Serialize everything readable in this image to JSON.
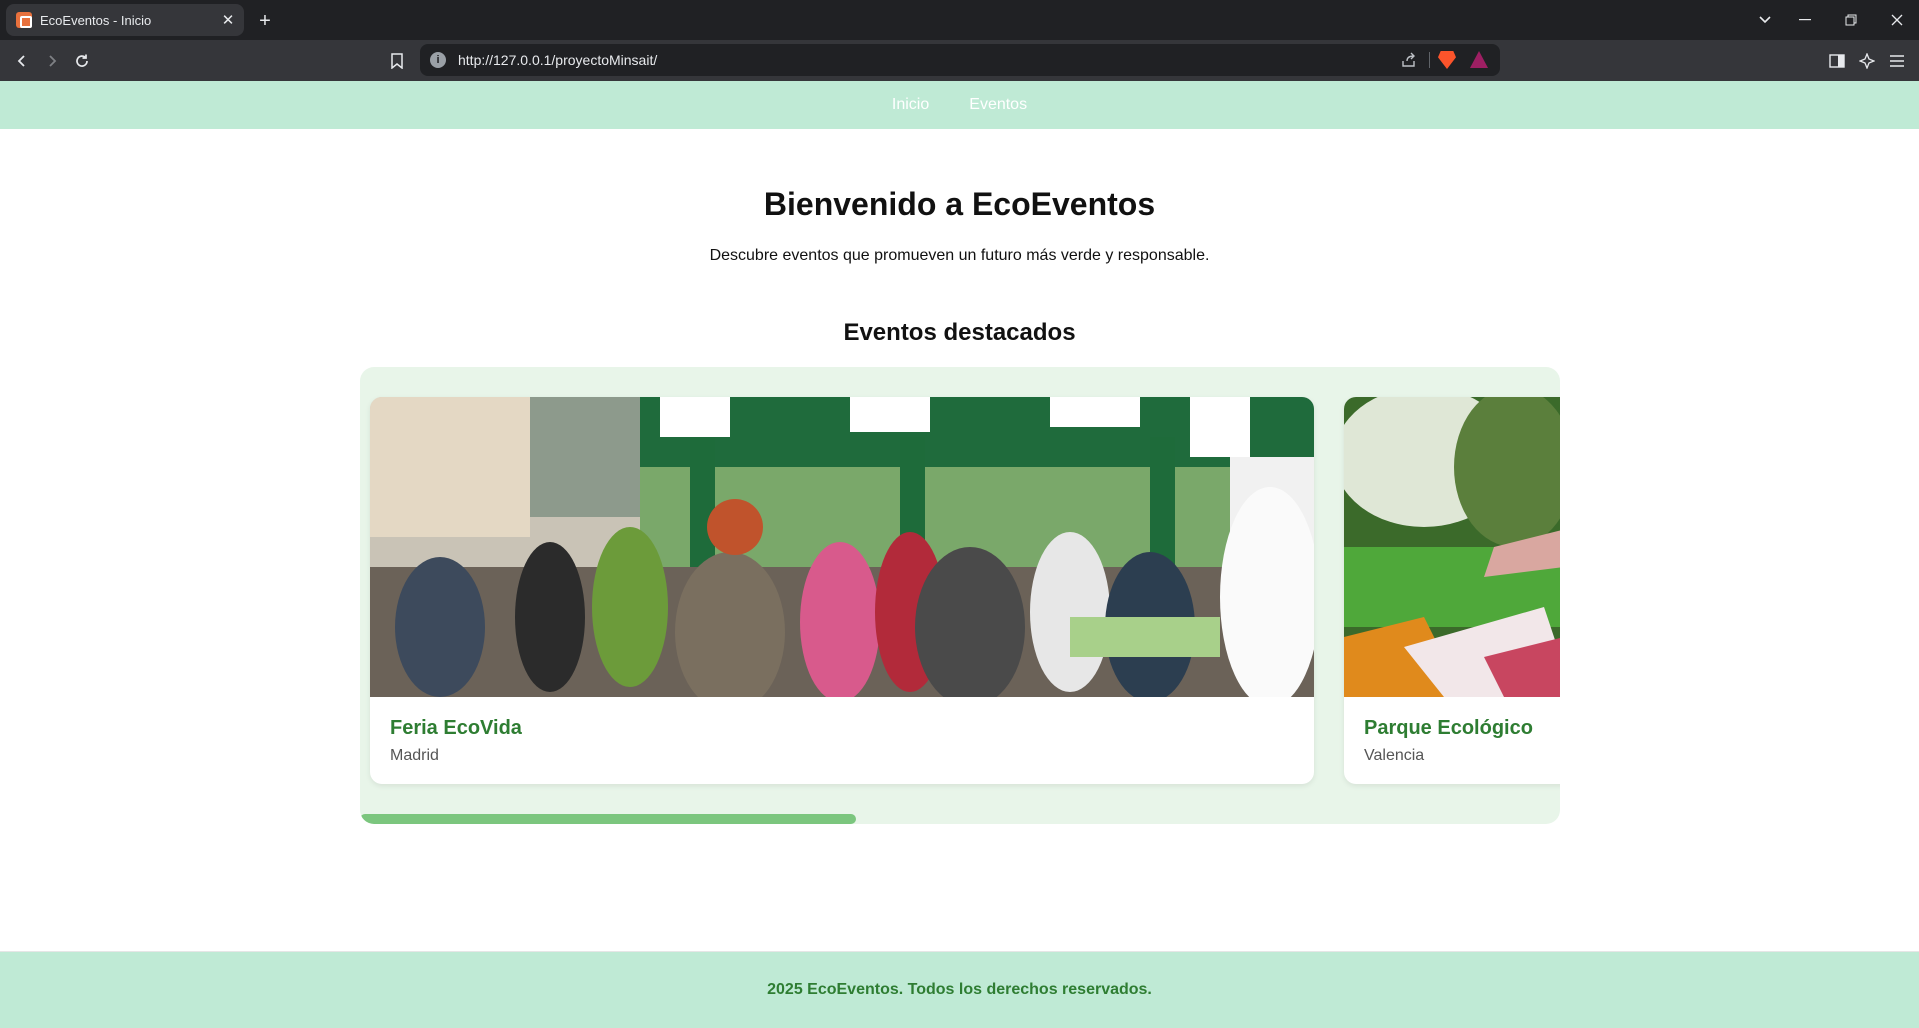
{
  "browser": {
    "tab_title": "EcoEventos - Inicio",
    "tab_close": "✕",
    "new_tab": "+",
    "url": "http://127.0.0.1/proyectoMinsait/",
    "icons": {
      "back": "back-arrow-icon",
      "forward": "forward-arrow-icon",
      "reload": "reload-icon",
      "bookmark": "bookmark-icon",
      "info": "info-icon",
      "share": "share-icon",
      "brave_shields": "brave-shields-icon",
      "brave_rewards": "brave-rewards-icon",
      "sidebar": "sidebar-icon",
      "leo": "leo-ai-icon",
      "menu": "menu-icon"
    }
  },
  "nav": {
    "items": [
      {
        "label": "Inicio"
      },
      {
        "label": "Eventos"
      }
    ]
  },
  "hero": {
    "title": "Bienvenido a EcoEventos",
    "subtitle": "Descubre eventos que promueven un futuro más verde y responsable."
  },
  "featured": {
    "title": "Eventos destacados",
    "cards": [
      {
        "title": "Feria EcoVida",
        "city": "Madrid"
      },
      {
        "title": "Parque Ecológico",
        "city": "Valencia"
      }
    ],
    "scroll_progress": 0.41
  },
  "footer": {
    "text": "2025 EcoEventos. Todos los derechos reservados."
  },
  "colors": {
    "nav_bg": "#bfead5",
    "accent_green": "#2e7d32",
    "carousel_bg": "#e8f5e9",
    "scroll_thumb": "#7bc67e"
  }
}
